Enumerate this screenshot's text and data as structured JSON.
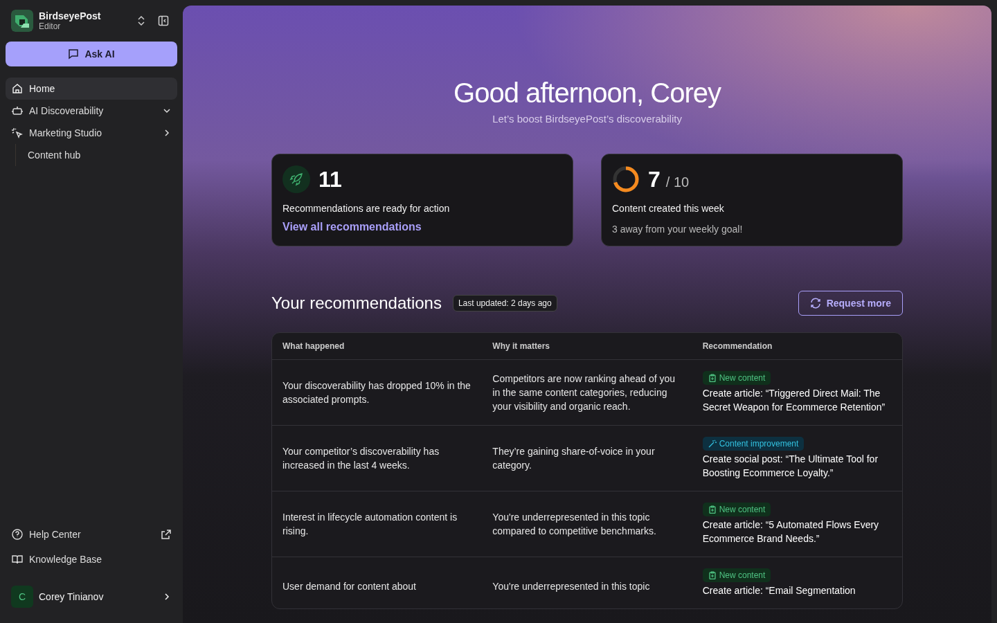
{
  "workspace": {
    "name": "BirdseyePost",
    "role": "Editor"
  },
  "ask_button": "Ask AI",
  "nav": [
    {
      "label": "Home",
      "kind": "home",
      "selected": true
    },
    {
      "label": "AI Discoverability",
      "kind": "robot",
      "selected": false,
      "expanded": true
    },
    {
      "label": "Marketing Studio",
      "kind": "sparkle",
      "selected": false,
      "expanded": false,
      "children": [
        {
          "label": "Content hub",
          "selected": false
        }
      ]
    }
  ],
  "footer_links": [
    {
      "label": "Help Center",
      "kind": "help",
      "external": true
    },
    {
      "label": "Knowledge Base",
      "kind": "book",
      "external": false
    }
  ],
  "user": {
    "initial": "C",
    "name": "Corey Tinianov"
  },
  "greeting": {
    "title": "Good afternoon, Corey",
    "subtitle": "Let’s boost BirdseyePost’s discoverability"
  },
  "stats": [
    {
      "kind": "count",
      "value": "11",
      "label": "Recommendations are ready for action",
      "link": "View all recommendations"
    },
    {
      "kind": "progress",
      "value": "7",
      "total": "/ 10",
      "level": 0.7,
      "label": "Content created this week",
      "note": "3 away from your weekly goal!"
    }
  ],
  "recommendations": {
    "title": "Your recommendations",
    "updated": "Last updated: 2 days ago",
    "request_button": "Request more",
    "columns": [
      "What happened",
      "Why it matters",
      "Recommendation"
    ],
    "rows": [
      {
        "what": "Your discoverability has dropped 10% in the associated prompts.",
        "why": "Competitors are now ranking ahead of you in the same content categories, reducing your visibility and organic reach.",
        "tag": {
          "kind": "new",
          "label": "New content"
        },
        "action": "Create article: “Triggered Direct Mail: The Secret Weapon for Ecommerce Retention”"
      },
      {
        "what": "Your competitor’s discoverability has increased in the last 4 weeks.",
        "why": "They’re gaining share-of-voice in your category.",
        "tag": {
          "kind": "improvement",
          "label": "Content improvement"
        },
        "action": "Create social post: “The Ultimate Tool for Boosting Ecommerce Loyalty.”"
      },
      {
        "what": "Interest in lifecycle automation content is rising.",
        "why": "You're underrepresented in this topic compared to competitive benchmarks.",
        "tag": {
          "kind": "new",
          "label": "New content"
        },
        "action": "Create article: “5 Automated Flows Every Ecommerce Brand Needs.”"
      },
      {
        "what": "User demand for content about",
        "why": "You're underrepresented in this topic",
        "tag": {
          "kind": "new",
          "label": "New content"
        },
        "action": "Create article: “Email Segmentation"
      }
    ]
  }
}
